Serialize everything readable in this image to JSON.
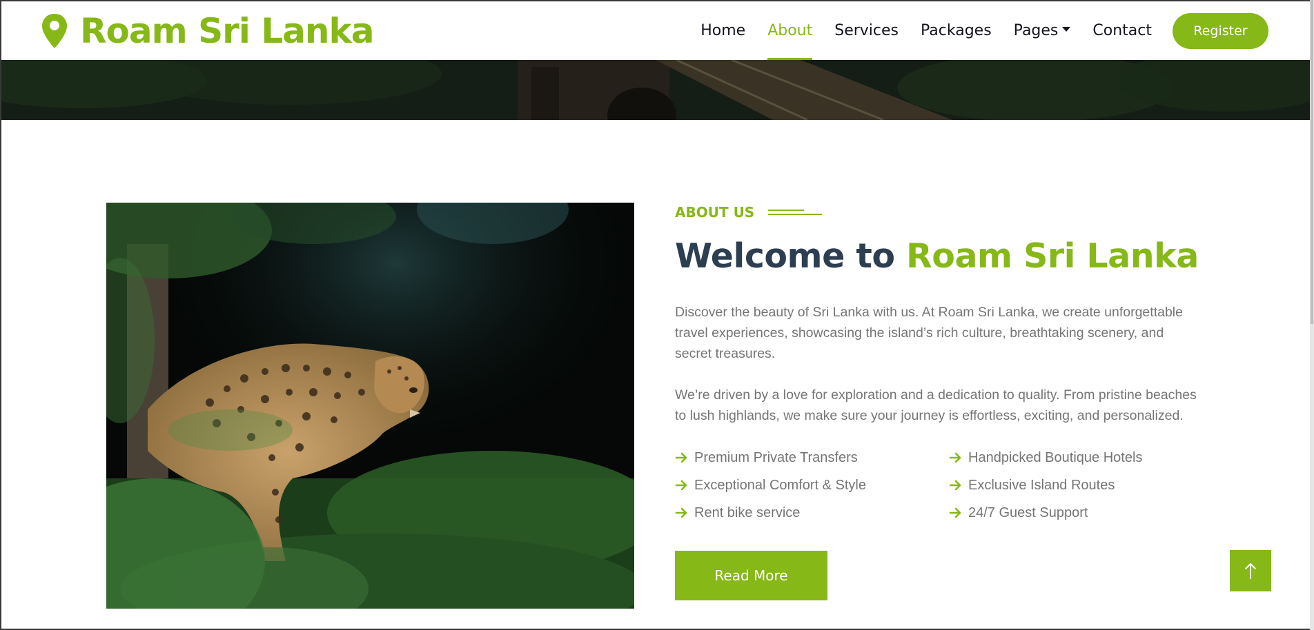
{
  "brand": {
    "name": "Roam Sri Lanka",
    "icon": "map-pin-icon"
  },
  "nav": {
    "items": [
      {
        "label": "Home",
        "active": false
      },
      {
        "label": "About",
        "active": true
      },
      {
        "label": "Services",
        "active": false
      },
      {
        "label": "Packages",
        "active": false
      },
      {
        "label": "Pages",
        "active": false,
        "dropdown": true
      },
      {
        "label": "Contact",
        "active": false
      }
    ],
    "register_label": "Register"
  },
  "about": {
    "eyebrow": "ABOUT US",
    "heading_prefix": "Welcome to ",
    "heading_accent": "Roam Sri Lanka",
    "paragraphs": [
      "Discover the beauty of Sri Lanka with us. At Roam Sri Lanka, we create unforgettable travel experiences, showcasing the island’s rich culture, breathtaking scenery, and secret treasures.",
      "We’re driven by a love for exploration and a dedication to quality. From pristine beaches to lush highlands, we make sure your journey is effortless, exciting, and personalized."
    ],
    "features": [
      "Premium Private Transfers",
      "Handpicked Boutique Hotels",
      "Exceptional Comfort & Style",
      "Exclusive Island Routes",
      "Rent bike service",
      "24/7 Guest Support"
    ],
    "read_more_label": "Read More"
  },
  "colors": {
    "accent": "#86b817",
    "heading": "#2c3e50",
    "body_text": "#757575",
    "nav_text": "#14141f"
  },
  "icons": {
    "feature_bullet": "arrow-right-icon",
    "back_to_top": "arrow-up-icon"
  }
}
